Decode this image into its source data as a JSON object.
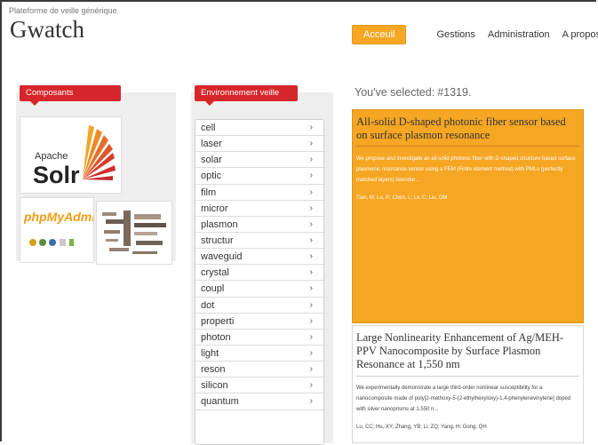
{
  "header": {
    "subtitle": "Plateforme de veille générique",
    "title": "Gwatch"
  },
  "nav": {
    "items": [
      "Acceuil",
      "Gestions",
      "Administration",
      "A propos"
    ],
    "active": "Acceuil",
    "accent": "#f5a623"
  },
  "panels": {
    "left_title": "Composants",
    "mid_title": "Environnement veille",
    "tab_color": "#d7262a"
  },
  "logos": {
    "solr_text": "Apache",
    "solr_brand": "Solr",
    "pma_text": "phpMyAdmin"
  },
  "keywords": [
    "cell",
    "laser",
    "solar",
    "optic",
    "film",
    "micror",
    "plasmon",
    "structur",
    "waveguid",
    "crystal",
    "coupl",
    "dot",
    "properti",
    "photon",
    "light",
    "reson",
    "silicon",
    "quantum"
  ],
  "selection": {
    "label": "You've selected:",
    "value": "#1319."
  },
  "results": [
    {
      "title": "All-solid D-shaped photonic fiber sensor based on surface plasmon resonance",
      "abstract": "We propose and investigate an all-solid photonic fiber with D-shaped structure based surface plasmonic resonance sensor using a FEM (Finite element method) with PMLs (perfectly matched layers) boundar...",
      "authors": "Tian, M; Lu, P; Chen, L; Lv, C; Liu, DM"
    },
    {
      "title": "Large Nonlinearity Enhancement of Ag/MEH-PPV Nanocomposite by Surface Plasmon Resonance at 1,550 nm",
      "abstract": "We experimentally demonstrate a large third-order nonlinear susceptibility for a nanocomposite made of poly[2-methoxy-5-(2-ethylhexyloxy)-1,4-phenylenevinylene] doped with silver nanoprisms at 1.550 n...",
      "authors": "Lu, CC; Hu, XY; Zhang, YB; Li, ZQ; Yang, H; Gong, QH"
    }
  ]
}
